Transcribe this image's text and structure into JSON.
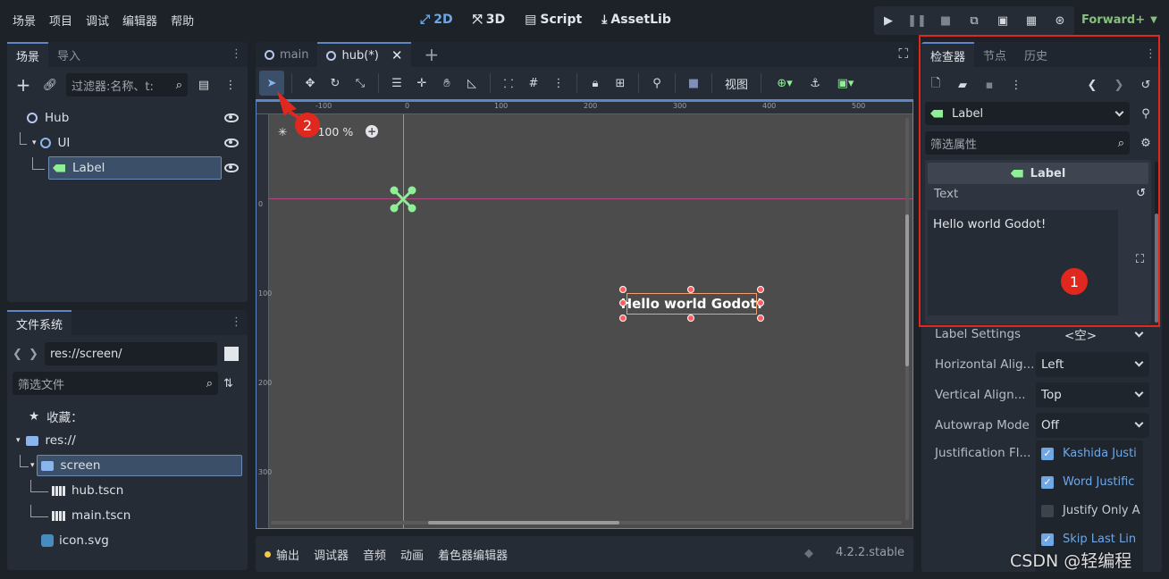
{
  "menu": [
    "场景",
    "项目",
    "调试",
    "编辑器",
    "帮助"
  ],
  "topcenter": {
    "mode_2d": "2D",
    "mode_3d": "3D",
    "script": "Script",
    "assetlib": "AssetLib"
  },
  "renderer": "Forward+",
  "left_top": {
    "tabs": [
      "场景",
      "导入"
    ],
    "filter_placeholder": "过滤器:名称、t:",
    "tree": [
      {
        "label": "Hub",
        "icon": "node-circle-icon"
      },
      {
        "label": "UI",
        "icon": "control-circle-icon"
      },
      {
        "label": "Label",
        "icon": "label-icon"
      }
    ]
  },
  "filesystem": {
    "tab": "文件系统",
    "path": "res://screen/",
    "filter_placeholder": "筛选文件",
    "favorites": "收藏：",
    "res": "res://",
    "screen": "screen",
    "files": [
      "hub.tscn",
      "main.tscn"
    ],
    "icon_file": "icon.svg"
  },
  "editor_tabs": [
    "main",
    "hub(*)"
  ],
  "toolbar": {
    "view": "视图"
  },
  "viewport": {
    "zoom": "100 %",
    "ruler_top": [
      "-100",
      "0",
      "100",
      "200",
      "300",
      "400",
      "500"
    ],
    "ruler_left": [
      "0",
      "100",
      "200",
      "300"
    ],
    "label_text": "Hello world Godot!"
  },
  "bottom": {
    "items": [
      "输出",
      "调试器",
      "音频",
      "动画",
      "着色器编辑器"
    ],
    "version": "4.2.2.stable"
  },
  "inspector": {
    "tabs": [
      "检查器",
      "节点",
      "历史"
    ],
    "node_type": "Label",
    "filter_placeholder": "筛选属性",
    "section": "Label",
    "text_label": "Text",
    "text_value": "Hello world Godot!",
    "rows": [
      {
        "label": "Label Settings",
        "value": "<空>"
      },
      {
        "label": "Horizontal Alig...",
        "value": "Left"
      },
      {
        "label": "Vertical Align...",
        "value": "Top"
      },
      {
        "label": "Autowrap Mode",
        "value": "Off"
      }
    ],
    "justification_label": "Justification Fl...",
    "flags": [
      {
        "label": "Kashida Justi",
        "checked": true
      },
      {
        "label": "Word Justific",
        "checked": true
      },
      {
        "label": "Justify Only A",
        "checked": false
      },
      {
        "label": "Skip Last Lin",
        "checked": true
      }
    ]
  },
  "annotations": {
    "one": "1",
    "two": "2"
  },
  "watermark": "CSDN @轻编程",
  "colors": {
    "accent": "#6fa7e6",
    "highlight_red": "#e0281e",
    "label_green": "#8eef97"
  }
}
